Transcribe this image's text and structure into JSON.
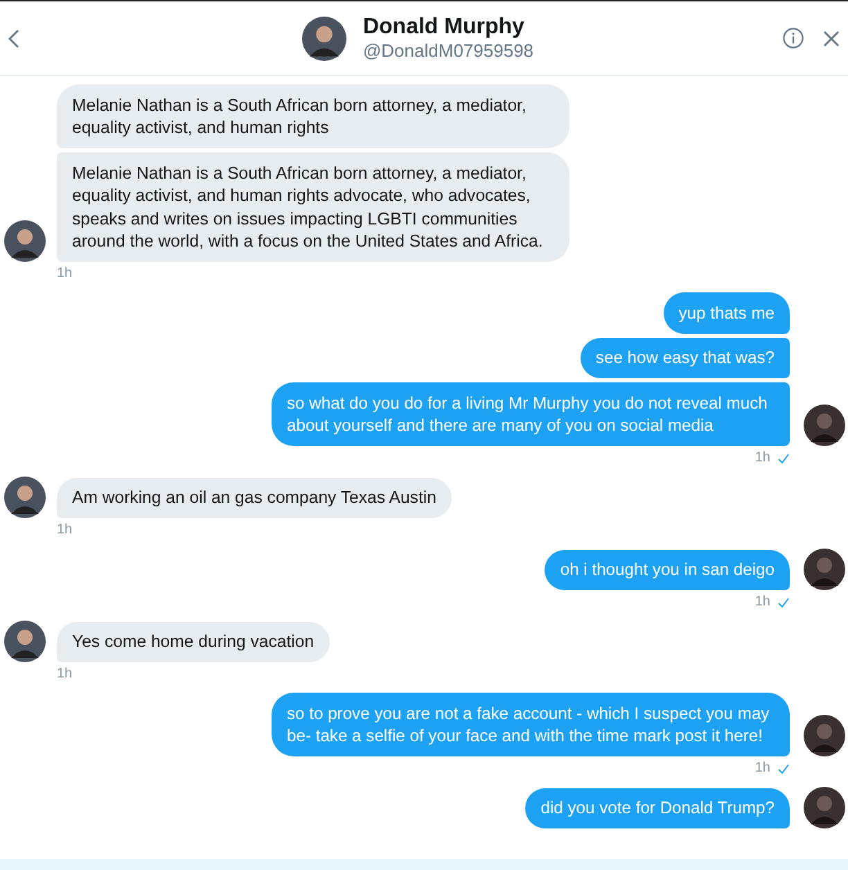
{
  "header": {
    "name": "Donald Murphy",
    "handle": "@DonaldM07959598"
  },
  "groups": [
    {
      "kind": "received",
      "messages": [
        "Melanie Nathan is a South African born attorney, a mediator, equality activist, and human rights",
        "Melanie Nathan is a South African born attorney, a mediator, equality activist, and human rights advocate, who advocates, speaks and writes on issues impacting LGBTI communities around the world, with a focus on the United States and Africa."
      ],
      "time": "1h"
    },
    {
      "kind": "sent",
      "messages": [
        "yup thats me",
        "see how easy that was?",
        "so what do you do for a living Mr Murphy you do not reveal much about yourself and there are many of you on social media"
      ],
      "time": "1h",
      "read": true
    },
    {
      "kind": "received",
      "messages": [
        "Am working an oil an gas company Texas Austin"
      ],
      "time": "1h"
    },
    {
      "kind": "sent",
      "messages": [
        "oh i thought you in san deigo"
      ],
      "time": "1h",
      "read": true
    },
    {
      "kind": "received",
      "messages": [
        "Yes come home during vacation"
      ],
      "time": "1h"
    },
    {
      "kind": "sent",
      "messages": [
        "so to prove you are not a fake account - which I suspect you may be- take a selfie of your face and with the time mark post it here!"
      ],
      "time": "1h",
      "read": true
    },
    {
      "kind": "sent",
      "messages": [
        "did you vote for Donald Trump?"
      ]
    }
  ]
}
